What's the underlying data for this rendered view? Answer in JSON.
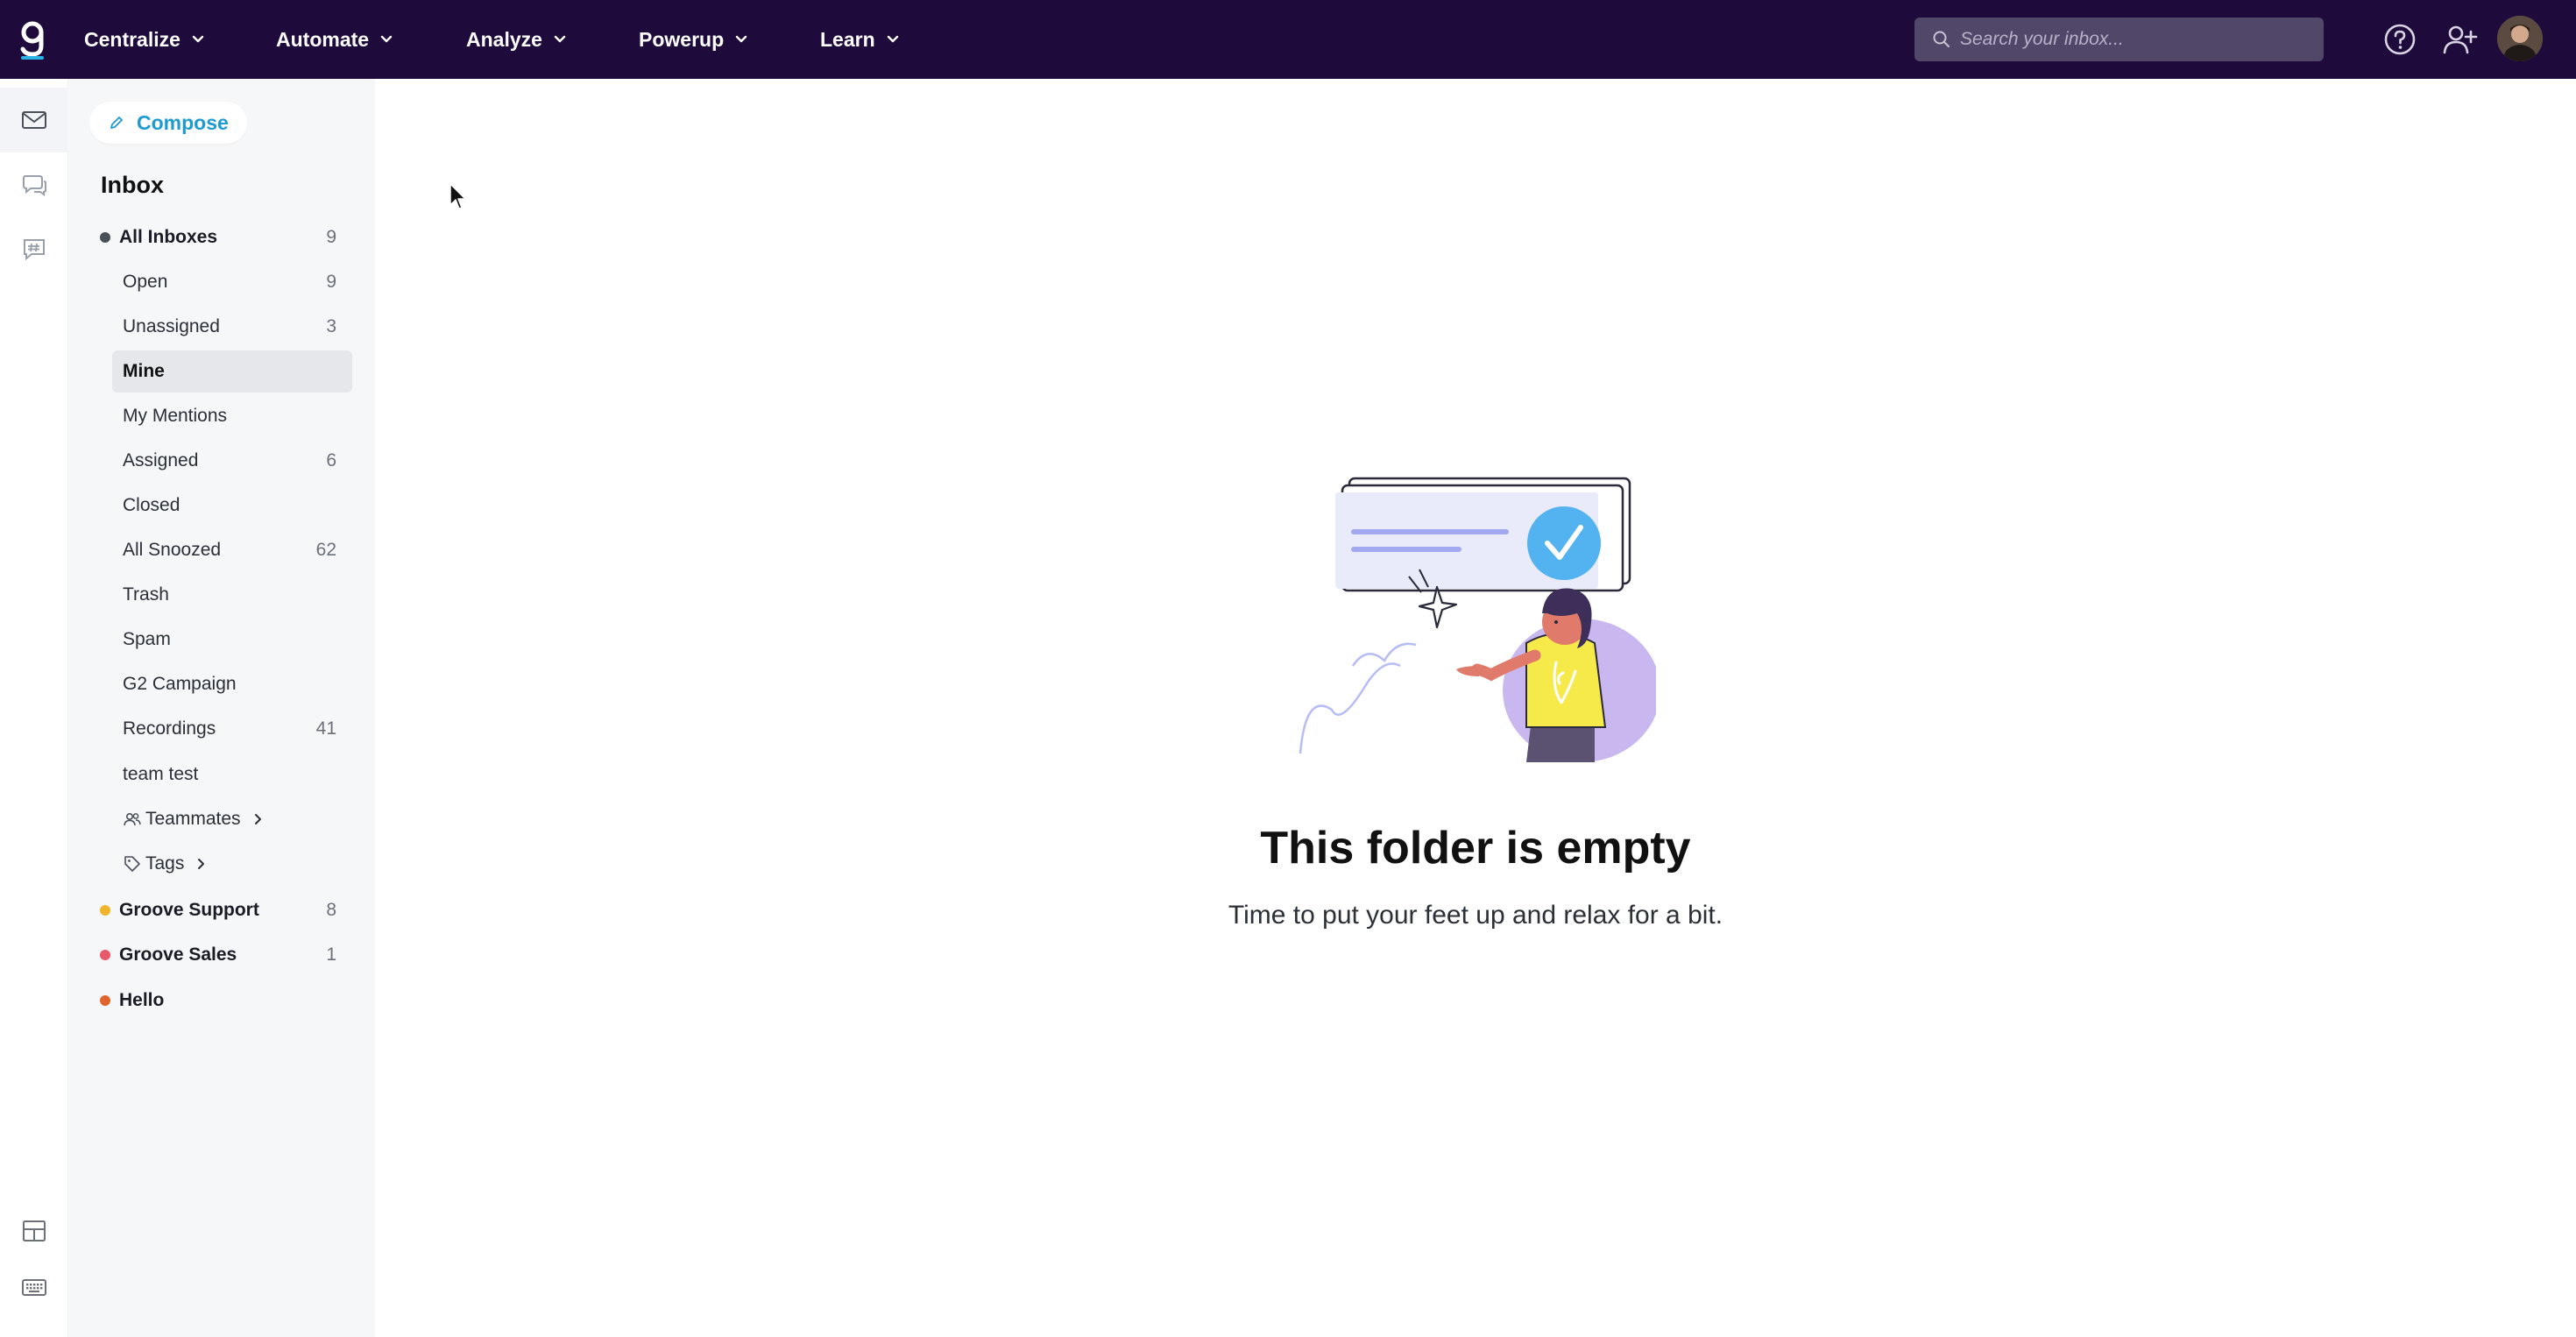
{
  "nav": {
    "items": [
      {
        "label": "Centralize"
      },
      {
        "label": "Automate"
      },
      {
        "label": "Analyze"
      },
      {
        "label": "Powerup"
      },
      {
        "label": "Learn"
      }
    ],
    "search_placeholder": "Search your inbox..."
  },
  "colors": {
    "topbar": "#1e0b3c",
    "accent": "#1d9bd1",
    "groove_support_dot": "#f0b52b",
    "groove_sales_dot": "#e8596b",
    "hello_dot": "#e0642c"
  },
  "sidebar": {
    "compose_label": "Compose",
    "heading": "Inbox",
    "all_inboxes": {
      "label": "All Inboxes",
      "count": "9"
    },
    "folders": [
      {
        "label": "Open",
        "count": "9"
      },
      {
        "label": "Unassigned",
        "count": "3"
      },
      {
        "label": "Mine",
        "count": ""
      },
      {
        "label": "My Mentions",
        "count": ""
      },
      {
        "label": "Assigned",
        "count": "6"
      },
      {
        "label": "Closed",
        "count": ""
      },
      {
        "label": "All Snoozed",
        "count": "62"
      },
      {
        "label": "Trash",
        "count": ""
      },
      {
        "label": "Spam",
        "count": ""
      },
      {
        "label": "G2 Campaign",
        "count": ""
      },
      {
        "label": "Recordings",
        "count": "41"
      },
      {
        "label": "team test",
        "count": ""
      }
    ],
    "teammates_label": "Teammates",
    "tags_label": "Tags",
    "mailboxes": [
      {
        "label": "Groove Support",
        "count": "8"
      },
      {
        "label": "Groove Sales",
        "count": "1"
      },
      {
        "label": "Hello",
        "count": ""
      }
    ]
  },
  "main": {
    "empty_title": "This folder is empty",
    "empty_subtitle": "Time to put your feet up and relax for a bit."
  }
}
